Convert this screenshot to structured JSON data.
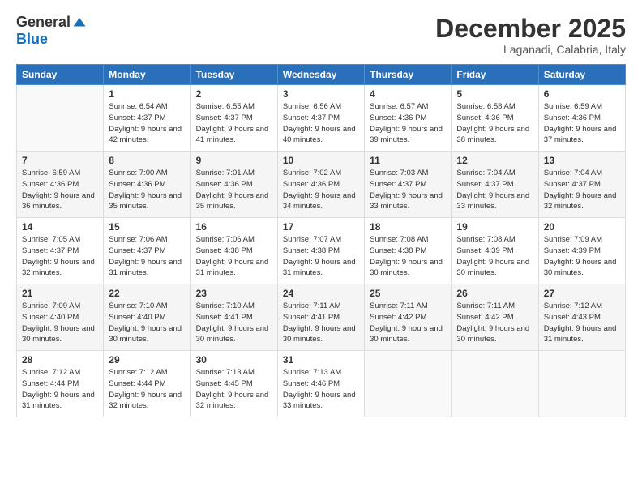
{
  "logo": {
    "general": "General",
    "blue": "Blue"
  },
  "title": "December 2025",
  "location": "Laganadi, Calabria, Italy",
  "weekdays": [
    "Sunday",
    "Monday",
    "Tuesday",
    "Wednesday",
    "Thursday",
    "Friday",
    "Saturday"
  ],
  "weeks": [
    [
      {
        "day": "",
        "sunrise": "",
        "sunset": "",
        "daylight": ""
      },
      {
        "day": "1",
        "sunrise": "Sunrise: 6:54 AM",
        "sunset": "Sunset: 4:37 PM",
        "daylight": "Daylight: 9 hours and 42 minutes."
      },
      {
        "day": "2",
        "sunrise": "Sunrise: 6:55 AM",
        "sunset": "Sunset: 4:37 PM",
        "daylight": "Daylight: 9 hours and 41 minutes."
      },
      {
        "day": "3",
        "sunrise": "Sunrise: 6:56 AM",
        "sunset": "Sunset: 4:37 PM",
        "daylight": "Daylight: 9 hours and 40 minutes."
      },
      {
        "day": "4",
        "sunrise": "Sunrise: 6:57 AM",
        "sunset": "Sunset: 4:36 PM",
        "daylight": "Daylight: 9 hours and 39 minutes."
      },
      {
        "day": "5",
        "sunrise": "Sunrise: 6:58 AM",
        "sunset": "Sunset: 4:36 PM",
        "daylight": "Daylight: 9 hours and 38 minutes."
      },
      {
        "day": "6",
        "sunrise": "Sunrise: 6:59 AM",
        "sunset": "Sunset: 4:36 PM",
        "daylight": "Daylight: 9 hours and 37 minutes."
      }
    ],
    [
      {
        "day": "7",
        "sunrise": "Sunrise: 6:59 AM",
        "sunset": "Sunset: 4:36 PM",
        "daylight": "Daylight: 9 hours and 36 minutes."
      },
      {
        "day": "8",
        "sunrise": "Sunrise: 7:00 AM",
        "sunset": "Sunset: 4:36 PM",
        "daylight": "Daylight: 9 hours and 35 minutes."
      },
      {
        "day": "9",
        "sunrise": "Sunrise: 7:01 AM",
        "sunset": "Sunset: 4:36 PM",
        "daylight": "Daylight: 9 hours and 35 minutes."
      },
      {
        "day": "10",
        "sunrise": "Sunrise: 7:02 AM",
        "sunset": "Sunset: 4:36 PM",
        "daylight": "Daylight: 9 hours and 34 minutes."
      },
      {
        "day": "11",
        "sunrise": "Sunrise: 7:03 AM",
        "sunset": "Sunset: 4:37 PM",
        "daylight": "Daylight: 9 hours and 33 minutes."
      },
      {
        "day": "12",
        "sunrise": "Sunrise: 7:04 AM",
        "sunset": "Sunset: 4:37 PM",
        "daylight": "Daylight: 9 hours and 33 minutes."
      },
      {
        "day": "13",
        "sunrise": "Sunrise: 7:04 AM",
        "sunset": "Sunset: 4:37 PM",
        "daylight": "Daylight: 9 hours and 32 minutes."
      }
    ],
    [
      {
        "day": "14",
        "sunrise": "Sunrise: 7:05 AM",
        "sunset": "Sunset: 4:37 PM",
        "daylight": "Daylight: 9 hours and 32 minutes."
      },
      {
        "day": "15",
        "sunrise": "Sunrise: 7:06 AM",
        "sunset": "Sunset: 4:37 PM",
        "daylight": "Daylight: 9 hours and 31 minutes."
      },
      {
        "day": "16",
        "sunrise": "Sunrise: 7:06 AM",
        "sunset": "Sunset: 4:38 PM",
        "daylight": "Daylight: 9 hours and 31 minutes."
      },
      {
        "day": "17",
        "sunrise": "Sunrise: 7:07 AM",
        "sunset": "Sunset: 4:38 PM",
        "daylight": "Daylight: 9 hours and 31 minutes."
      },
      {
        "day": "18",
        "sunrise": "Sunrise: 7:08 AM",
        "sunset": "Sunset: 4:38 PM",
        "daylight": "Daylight: 9 hours and 30 minutes."
      },
      {
        "day": "19",
        "sunrise": "Sunrise: 7:08 AM",
        "sunset": "Sunset: 4:39 PM",
        "daylight": "Daylight: 9 hours and 30 minutes."
      },
      {
        "day": "20",
        "sunrise": "Sunrise: 7:09 AM",
        "sunset": "Sunset: 4:39 PM",
        "daylight": "Daylight: 9 hours and 30 minutes."
      }
    ],
    [
      {
        "day": "21",
        "sunrise": "Sunrise: 7:09 AM",
        "sunset": "Sunset: 4:40 PM",
        "daylight": "Daylight: 9 hours and 30 minutes."
      },
      {
        "day": "22",
        "sunrise": "Sunrise: 7:10 AM",
        "sunset": "Sunset: 4:40 PM",
        "daylight": "Daylight: 9 hours and 30 minutes."
      },
      {
        "day": "23",
        "sunrise": "Sunrise: 7:10 AM",
        "sunset": "Sunset: 4:41 PM",
        "daylight": "Daylight: 9 hours and 30 minutes."
      },
      {
        "day": "24",
        "sunrise": "Sunrise: 7:11 AM",
        "sunset": "Sunset: 4:41 PM",
        "daylight": "Daylight: 9 hours and 30 minutes."
      },
      {
        "day": "25",
        "sunrise": "Sunrise: 7:11 AM",
        "sunset": "Sunset: 4:42 PM",
        "daylight": "Daylight: 9 hours and 30 minutes."
      },
      {
        "day": "26",
        "sunrise": "Sunrise: 7:11 AM",
        "sunset": "Sunset: 4:42 PM",
        "daylight": "Daylight: 9 hours and 30 minutes."
      },
      {
        "day": "27",
        "sunrise": "Sunrise: 7:12 AM",
        "sunset": "Sunset: 4:43 PM",
        "daylight": "Daylight: 9 hours and 31 minutes."
      }
    ],
    [
      {
        "day": "28",
        "sunrise": "Sunrise: 7:12 AM",
        "sunset": "Sunset: 4:44 PM",
        "daylight": "Daylight: 9 hours and 31 minutes."
      },
      {
        "day": "29",
        "sunrise": "Sunrise: 7:12 AM",
        "sunset": "Sunset: 4:44 PM",
        "daylight": "Daylight: 9 hours and 32 minutes."
      },
      {
        "day": "30",
        "sunrise": "Sunrise: 7:13 AM",
        "sunset": "Sunset: 4:45 PM",
        "daylight": "Daylight: 9 hours and 32 minutes."
      },
      {
        "day": "31",
        "sunrise": "Sunrise: 7:13 AM",
        "sunset": "Sunset: 4:46 PM",
        "daylight": "Daylight: 9 hours and 33 minutes."
      },
      {
        "day": "",
        "sunrise": "",
        "sunset": "",
        "daylight": ""
      },
      {
        "day": "",
        "sunrise": "",
        "sunset": "",
        "daylight": ""
      },
      {
        "day": "",
        "sunrise": "",
        "sunset": "",
        "daylight": ""
      }
    ]
  ]
}
